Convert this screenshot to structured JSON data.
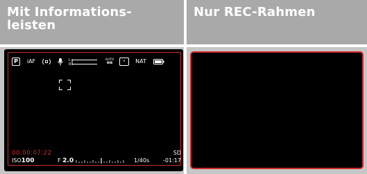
{
  "headers": {
    "left_line1": "Mit Informations-",
    "left_line2": "leisten",
    "right": "Nur REC-Rahmen"
  },
  "status_bar": {
    "iaf_label": "iAF",
    "auto_wb_top": "AUTO",
    "auto_wb_bottom": "WB",
    "nat_label": "NAT"
  },
  "bottom_bar": {
    "timecode": "00:00:07:22",
    "storage": "SD",
    "iso_prefix": "ISO",
    "iso_value": "100",
    "aperture_prefix": "F",
    "aperture_value": "2.0",
    "shutter": "1/40s",
    "exposure_comp": "-01:17"
  },
  "colors": {
    "header_bg": "#a9a9a9",
    "panel_bg": "#c6c6c6",
    "rec_frame": "#d22b2b",
    "screen_bg": "#000000"
  }
}
